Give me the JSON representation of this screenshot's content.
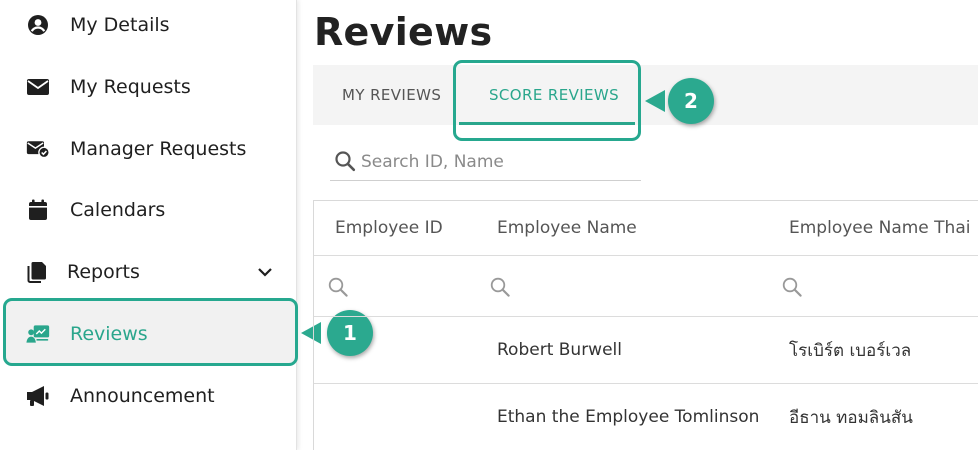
{
  "sidebar": {
    "items": [
      {
        "label": "My Details",
        "icon": "user-circle-icon"
      },
      {
        "label": "My Requests",
        "icon": "envelope-icon"
      },
      {
        "label": "Manager Requests",
        "icon": "envelope-check-icon"
      },
      {
        "label": "Calendars",
        "icon": "calendar-icon"
      },
      {
        "label": "Reports",
        "icon": "documents-icon"
      },
      {
        "label": "Reviews",
        "icon": "review-chart-icon"
      },
      {
        "label": "Announcement",
        "icon": "megaphone-icon"
      }
    ],
    "active_item": "Reviews"
  },
  "callouts": {
    "first": "1",
    "second": "2"
  },
  "main": {
    "title": "Reviews",
    "tabs": [
      {
        "label": "MY REVIEWS",
        "active": false
      },
      {
        "label": "SCORE REVIEWS",
        "active": true
      }
    ],
    "search": {
      "placeholder": "Search ID, Name",
      "value": ""
    },
    "table": {
      "columns": [
        "Employee ID",
        "Employee Name",
        "Employee Name Thai"
      ],
      "rows": [
        {
          "employee_id": "",
          "employee_name": "Robert Burwell",
          "employee_name_thai": "โรเบิร์ต เบอร์เวล"
        },
        {
          "employee_id": "",
          "employee_name": "Ethan the Employee Tomlinson",
          "employee_name_thai": "อีธาน ทอมลินสัน"
        }
      ]
    }
  },
  "colors": {
    "accent": "#2aa68c",
    "callout": "#2ba98f",
    "active_bg": "#f1f1f1",
    "tab_bar_bg": "#f4f4f4"
  }
}
